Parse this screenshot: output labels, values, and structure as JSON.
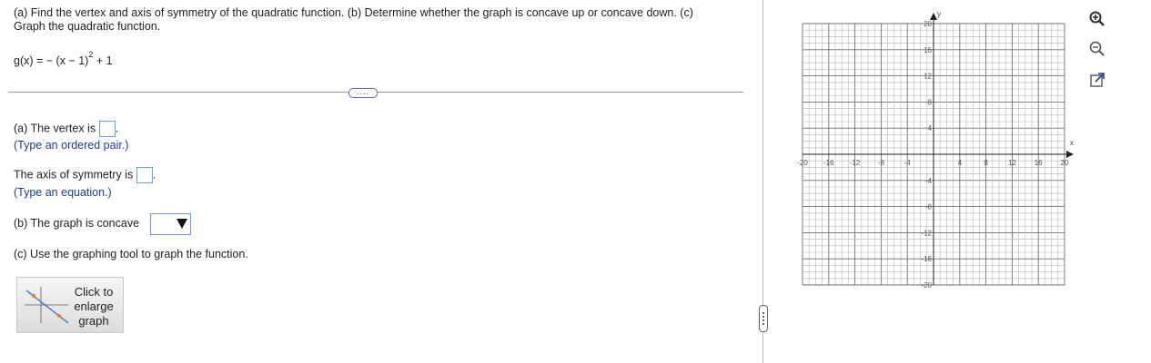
{
  "question": {
    "line1": "(a) Find the vertex and axis of symmetry of the quadratic function. (b) Determine whether the graph is concave up or concave down. (c)",
    "line2": "Graph the quadratic function.",
    "formula_pre": "g(x) = − (x − 1)",
    "formula_exp": "2",
    "formula_post": " + 1"
  },
  "expand_button": "....",
  "answers": {
    "a_label": "(a) The vertex is",
    "a_suffix": ".",
    "a_hint": "(Type an ordered pair.)",
    "axis_label": "The axis of symmetry is",
    "axis_suffix": ".",
    "axis_hint": "(Type an equation.)",
    "b_label": "(b) The graph is concave",
    "c_label": "(c) Use the graphing tool to graph the function."
  },
  "enlarge_button": {
    "line1": "Click to",
    "line2": "enlarge",
    "line3": "graph"
  },
  "graph": {
    "x_axis_label": "x",
    "y_axis_label": "y",
    "x_ticks": [
      "-20",
      "-16",
      "-12",
      "-8",
      "-4",
      "4",
      "8",
      "12",
      "16",
      "20"
    ],
    "y_ticks": [
      "20",
      "16",
      "12",
      "8",
      "4",
      "-4",
      "-8",
      "-12",
      "-16",
      "-20"
    ]
  },
  "tools": [
    "zoom-in-icon",
    "zoom-out-icon",
    "popout-icon"
  ],
  "colors": {
    "accent_blue": "#1a3f8f",
    "box_border": "#6f9be0",
    "grid": "#8a8a8a"
  }
}
